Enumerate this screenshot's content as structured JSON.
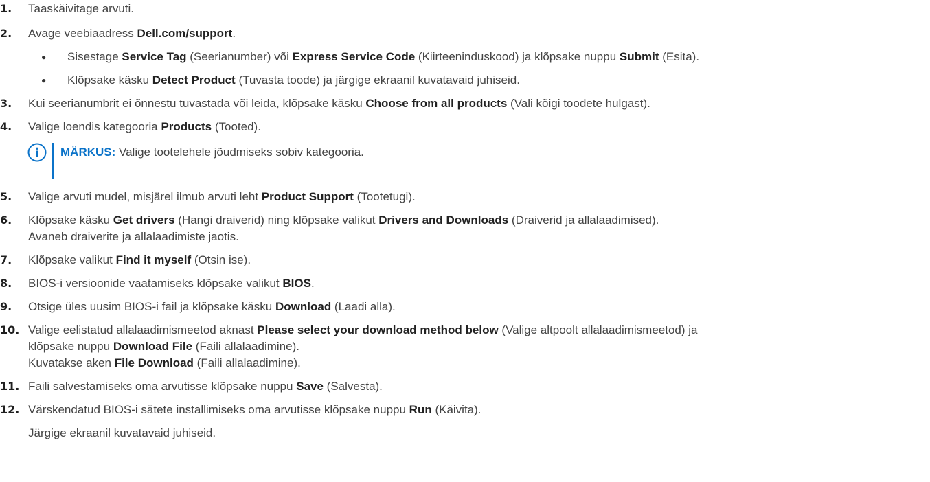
{
  "steps": [
    {
      "num": "1.",
      "parts": [
        {
          "t": "Taaskäivitage arvuti.",
          "b": false
        }
      ]
    },
    {
      "num": "2.",
      "parts": [
        {
          "t": "Avage veebiaadress ",
          "b": false
        },
        {
          "t": "Dell.com/support",
          "b": true
        },
        {
          "t": ".",
          "b": false
        }
      ]
    },
    {
      "num": "3.",
      "parts": [
        {
          "t": "Kui seerianumbrit ei õnnestu tuvastada või leida, klõpsake käsku ",
          "b": false
        },
        {
          "t": "Choose from all products",
          "b": true
        },
        {
          "t": " (Vali kõigi toodete hulgast).",
          "b": false
        }
      ]
    },
    {
      "num": "4.",
      "parts": [
        {
          "t": "Valige loendis kategooria ",
          "b": false
        },
        {
          "t": "Products",
          "b": true
        },
        {
          "t": " (Tooted).",
          "b": false
        }
      ]
    },
    {
      "num": "5.",
      "parts": [
        {
          "t": "Valige arvuti mudel, misjärel ilmub arvuti leht ",
          "b": false
        },
        {
          "t": "Product Support",
          "b": true
        },
        {
          "t": " (Tootetugi).",
          "b": false
        }
      ]
    },
    {
      "num": "6.",
      "parts": [
        {
          "t": "Klõpsake käsku ",
          "b": false
        },
        {
          "t": "Get drivers",
          "b": true
        },
        {
          "t": " (Hangi draiverid) ning klõpsake valikut ",
          "b": false
        },
        {
          "t": "Drivers and Downloads",
          "b": true
        },
        {
          "t": " (Draiverid ja allalaadimised).",
          "b": false
        }
      ]
    },
    {
      "num": "",
      "parts": [
        {
          "t": "Avaneb draiverite ja allalaadimiste jaotis.",
          "b": false
        }
      ]
    },
    {
      "num": "7.",
      "parts": [
        {
          "t": "Klõpsake valikut ",
          "b": false
        },
        {
          "t": "Find it myself",
          "b": true
        },
        {
          "t": " (Otsin ise).",
          "b": false
        }
      ]
    },
    {
      "num": "8.",
      "parts": [
        {
          "t": "BIOS-i versioonide vaatamiseks klõpsake valikut ",
          "b": false
        },
        {
          "t": "BIOS",
          "b": true
        },
        {
          "t": ".",
          "b": false
        }
      ]
    },
    {
      "num": "9.",
      "parts": [
        {
          "t": "Otsige üles uusim BIOS-i fail ja klõpsake käsku ",
          "b": false
        },
        {
          "t": "Download",
          "b": true
        },
        {
          "t": " (Laadi alla).",
          "b": false
        }
      ]
    },
    {
      "num": "10.",
      "parts": [
        {
          "t": "Valige eelistatud allalaadimismeetod aknast ",
          "b": false
        },
        {
          "t": "Please select your download method below",
          "b": true
        },
        {
          "t": " (Valige altpoolt allalaadimismeetod) ja",
          "b": false
        }
      ]
    },
    {
      "num": "",
      "parts": [
        {
          "t": "klõpsake nuppu ",
          "b": false
        },
        {
          "t": "Download File",
          "b": true
        },
        {
          "t": " (Faili allalaadimine).",
          "b": false
        }
      ]
    },
    {
      "num": "",
      "parts": [
        {
          "t": "Kuvatakse aken ",
          "b": false
        },
        {
          "t": "File Download",
          "b": true
        },
        {
          "t": " (Faili allalaadimine).",
          "b": false
        }
      ]
    },
    {
      "num": "11.",
      "parts": [
        {
          "t": "Faili salvestamiseks oma arvutisse klõpsake nuppu ",
          "b": false
        },
        {
          "t": "Save",
          "b": true
        },
        {
          "t": " (Salvesta).",
          "b": false
        }
      ]
    },
    {
      "num": "12.",
      "parts": [
        {
          "t": "Värskendatud BIOS-i sätete installimiseks oma arvutisse klõpsake nuppu ",
          "b": false
        },
        {
          "t": "Run",
          "b": true
        },
        {
          "t": " (Käivita).",
          "b": false
        }
      ]
    },
    {
      "num": "",
      "parts": [
        {
          "t": "Järgige ekraanil kuvatavaid juhiseid.",
          "b": false
        }
      ]
    }
  ],
  "bullets": [
    {
      "symbol": "●",
      "parts": [
        {
          "t": "Sisestage ",
          "b": false
        },
        {
          "t": "Service Tag",
          "b": true
        },
        {
          "t": " (Seerianumber) või ",
          "b": false
        },
        {
          "t": "Express Service Code",
          "b": true
        },
        {
          "t": " (Kiirteeninduskood) ja klõpsake nuppu ",
          "b": false
        },
        {
          "t": "Submit",
          "b": true
        },
        {
          "t": " (Esita).",
          "b": false
        }
      ]
    },
    {
      "symbol": "●",
      "parts": [
        {
          "t": "Klõpsake käsku ",
          "b": false
        },
        {
          "t": "Detect Product",
          "b": true
        },
        {
          "t": " (Tuvasta toode) ja järgige ekraanil kuvatavaid juhiseid.",
          "b": false
        }
      ]
    }
  ],
  "note": {
    "icon": "info-icon",
    "label": "MÄRKUS:",
    "text": " Valige tootelehele jõudmiseks sobiv kategooria."
  },
  "colors": {
    "accent": "#0b73c9",
    "text": "#444444"
  }
}
